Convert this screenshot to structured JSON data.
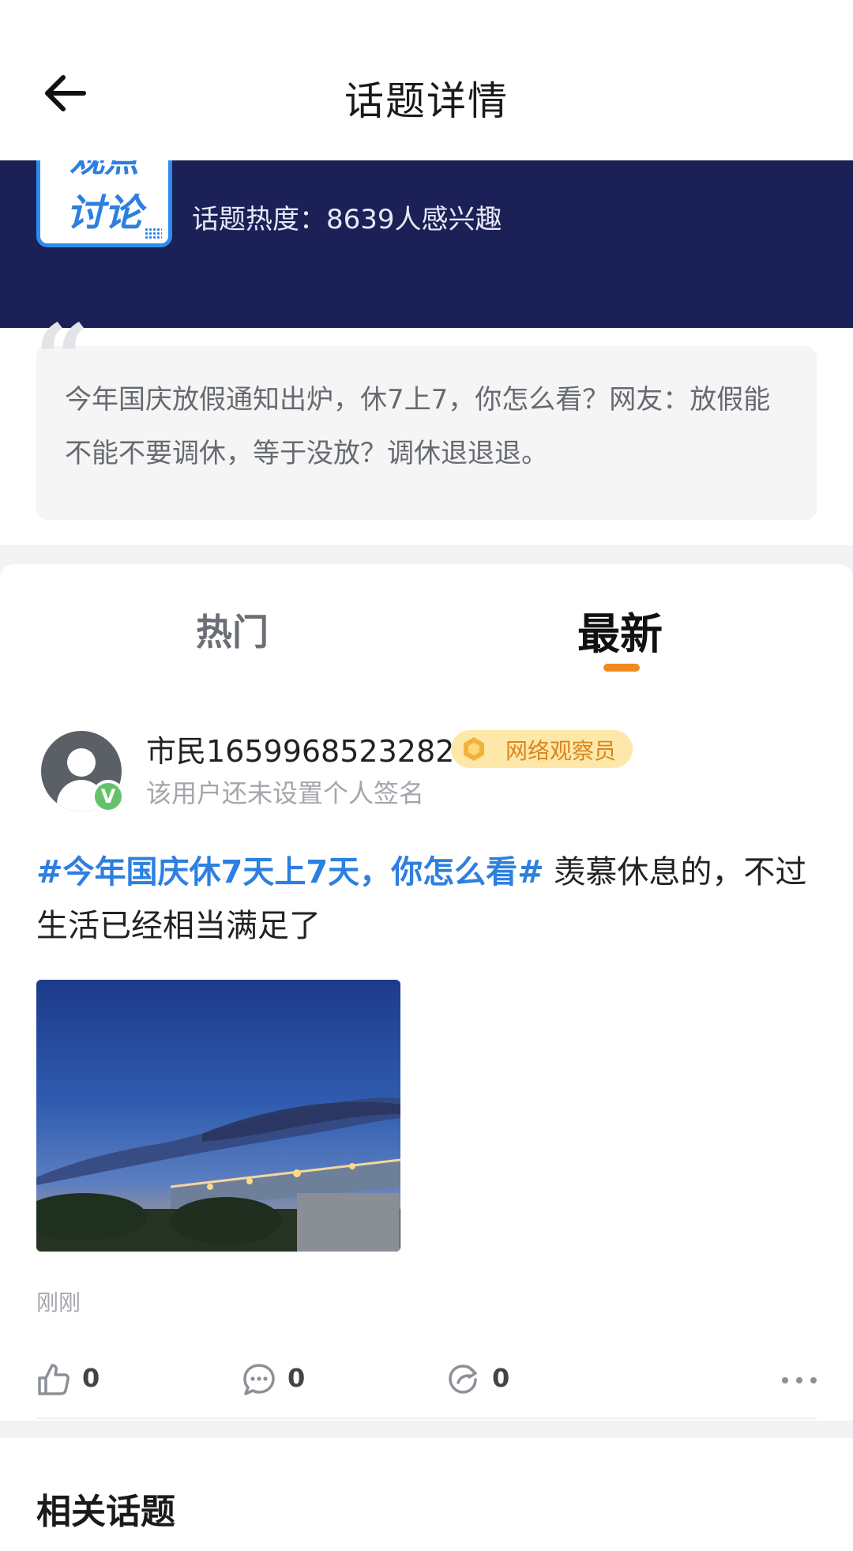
{
  "header": {
    "title": "话题详情"
  },
  "topic": {
    "badge_line1": "观点",
    "badge_line2": "讨论",
    "heat_text": "话题热度：8639人感兴趣",
    "intro": "今年国庆放假通知出炉，休7上7，你怎么看？网友：放假能不能不要调休，等于没放？调休退退退。"
  },
  "tabs": [
    {
      "label": "热门",
      "active": false
    },
    {
      "label": "最新",
      "active": true
    }
  ],
  "post": {
    "username": "市民1659968523282",
    "rank": "网络观察员",
    "signature": "该用户还未设置个人签名",
    "verified_mark": "V",
    "hashtag": "#今年国庆休7天上7天，你怎么看#",
    "text": " 羡慕休息的，不过生活已经相当满足了",
    "time": "刚刚",
    "like_count": "0",
    "comment_count": "0",
    "share_count": "0"
  },
  "related": {
    "title": "相关话题"
  },
  "colors": {
    "accent_blue": "#2d7fe0",
    "banner_navy": "#1b2157",
    "tab_indicator": "#f08a1c",
    "rank_badge_bg": "#fde8a9"
  }
}
